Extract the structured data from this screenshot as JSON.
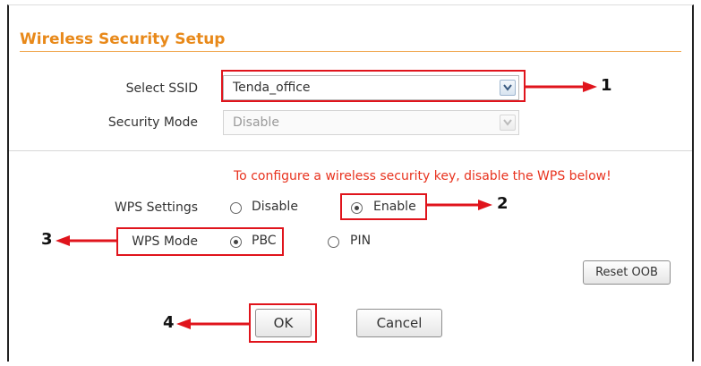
{
  "section": {
    "title": "Wireless Security Setup"
  },
  "ssid": {
    "label": "Select SSID",
    "value": "Tenda_office"
  },
  "security_mode": {
    "label": "Security Mode",
    "value": "Disable"
  },
  "warning": "To configure a wireless security key, disable the WPS below!",
  "wps_settings": {
    "label": "WPS Settings",
    "options": [
      "Disable",
      "Enable"
    ],
    "selected": "Enable"
  },
  "wps_mode": {
    "label": "WPS Mode",
    "options": [
      "PBC",
      "PIN"
    ],
    "selected": "PBC"
  },
  "buttons": {
    "reset": "Reset OOB",
    "ok": "OK",
    "cancel": "Cancel"
  },
  "annotations": [
    "1",
    "2",
    "3",
    "4"
  ],
  "colors": {
    "title": "#e8891a",
    "warning": "#e8331f",
    "highlight": "#e0141c"
  }
}
